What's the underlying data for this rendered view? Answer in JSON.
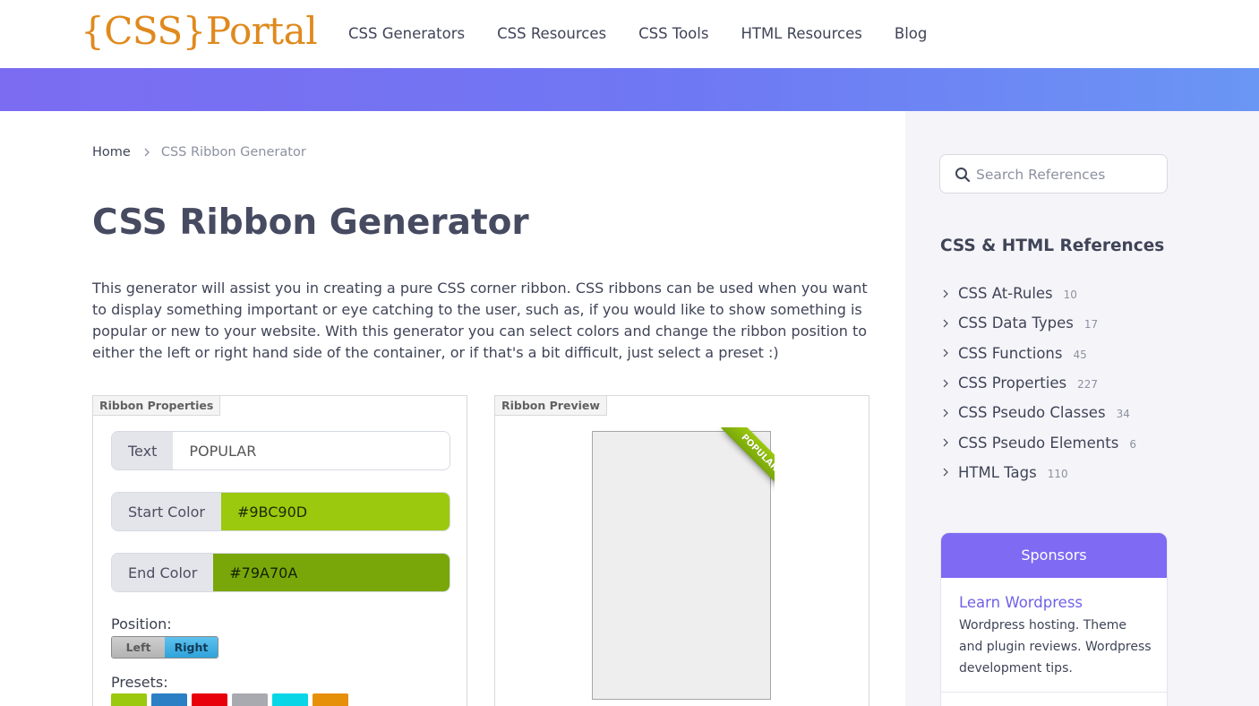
{
  "header": {
    "logo": "{CSS}Portal",
    "nav": [
      "CSS Generators",
      "CSS Resources",
      "CSS Tools",
      "HTML Resources",
      "Blog"
    ]
  },
  "breadcrumb": {
    "home": "Home",
    "current": "CSS Ribbon Generator"
  },
  "page": {
    "title": "CSS Ribbon Generator",
    "intro": "This generator will assist you in creating a pure CSS corner ribbon. CSS ribbons can be used when you want to display something important or eye catching to the user, such as, if you would like to show something is popular or new to your website. With this generator you can select colors and change the ribbon position to either the left or right hand side of the container, or if that's a bit difficult, just select a preset :)"
  },
  "properties": {
    "legend": "Ribbon Properties",
    "text_label": "Text",
    "text_value": "POPULAR",
    "start_label": "Start Color",
    "start_value": "#9BC90D",
    "end_label": "End Color",
    "end_value": "#79A70A",
    "position_label": "Position:",
    "position_left": "Left",
    "position_right": "Right",
    "position_selected": "Right",
    "presets_label": "Presets:",
    "preset_colors": [
      "#9bc90d",
      "#2b7fc4",
      "#e8000b",
      "#a9a9b0",
      "#08d6e6",
      "#e6900a"
    ]
  },
  "preview": {
    "legend": "Ribbon Preview",
    "ribbon_text": "POPULAR"
  },
  "sidebar": {
    "search_placeholder": "Search References",
    "refs_title": "CSS & HTML References",
    "refs": [
      {
        "label": "CSS At-Rules",
        "count": "10"
      },
      {
        "label": "CSS Data Types",
        "count": "17"
      },
      {
        "label": "CSS Functions",
        "count": "45"
      },
      {
        "label": "CSS Properties",
        "count": "227"
      },
      {
        "label": "CSS Pseudo Classes",
        "count": "34"
      },
      {
        "label": "CSS Pseudo Elements",
        "count": "6"
      },
      {
        "label": "HTML Tags",
        "count": "110"
      }
    ],
    "sponsors": {
      "title": "Sponsors",
      "link": "Learn Wordpress",
      "desc": "Wordpress hosting. Theme and plugin reviews. Wordpress development tips."
    }
  },
  "colors": {
    "accent": "#7e6af3",
    "logo": "#e0891d",
    "start": "#9bc90d",
    "end": "#79a70a"
  }
}
